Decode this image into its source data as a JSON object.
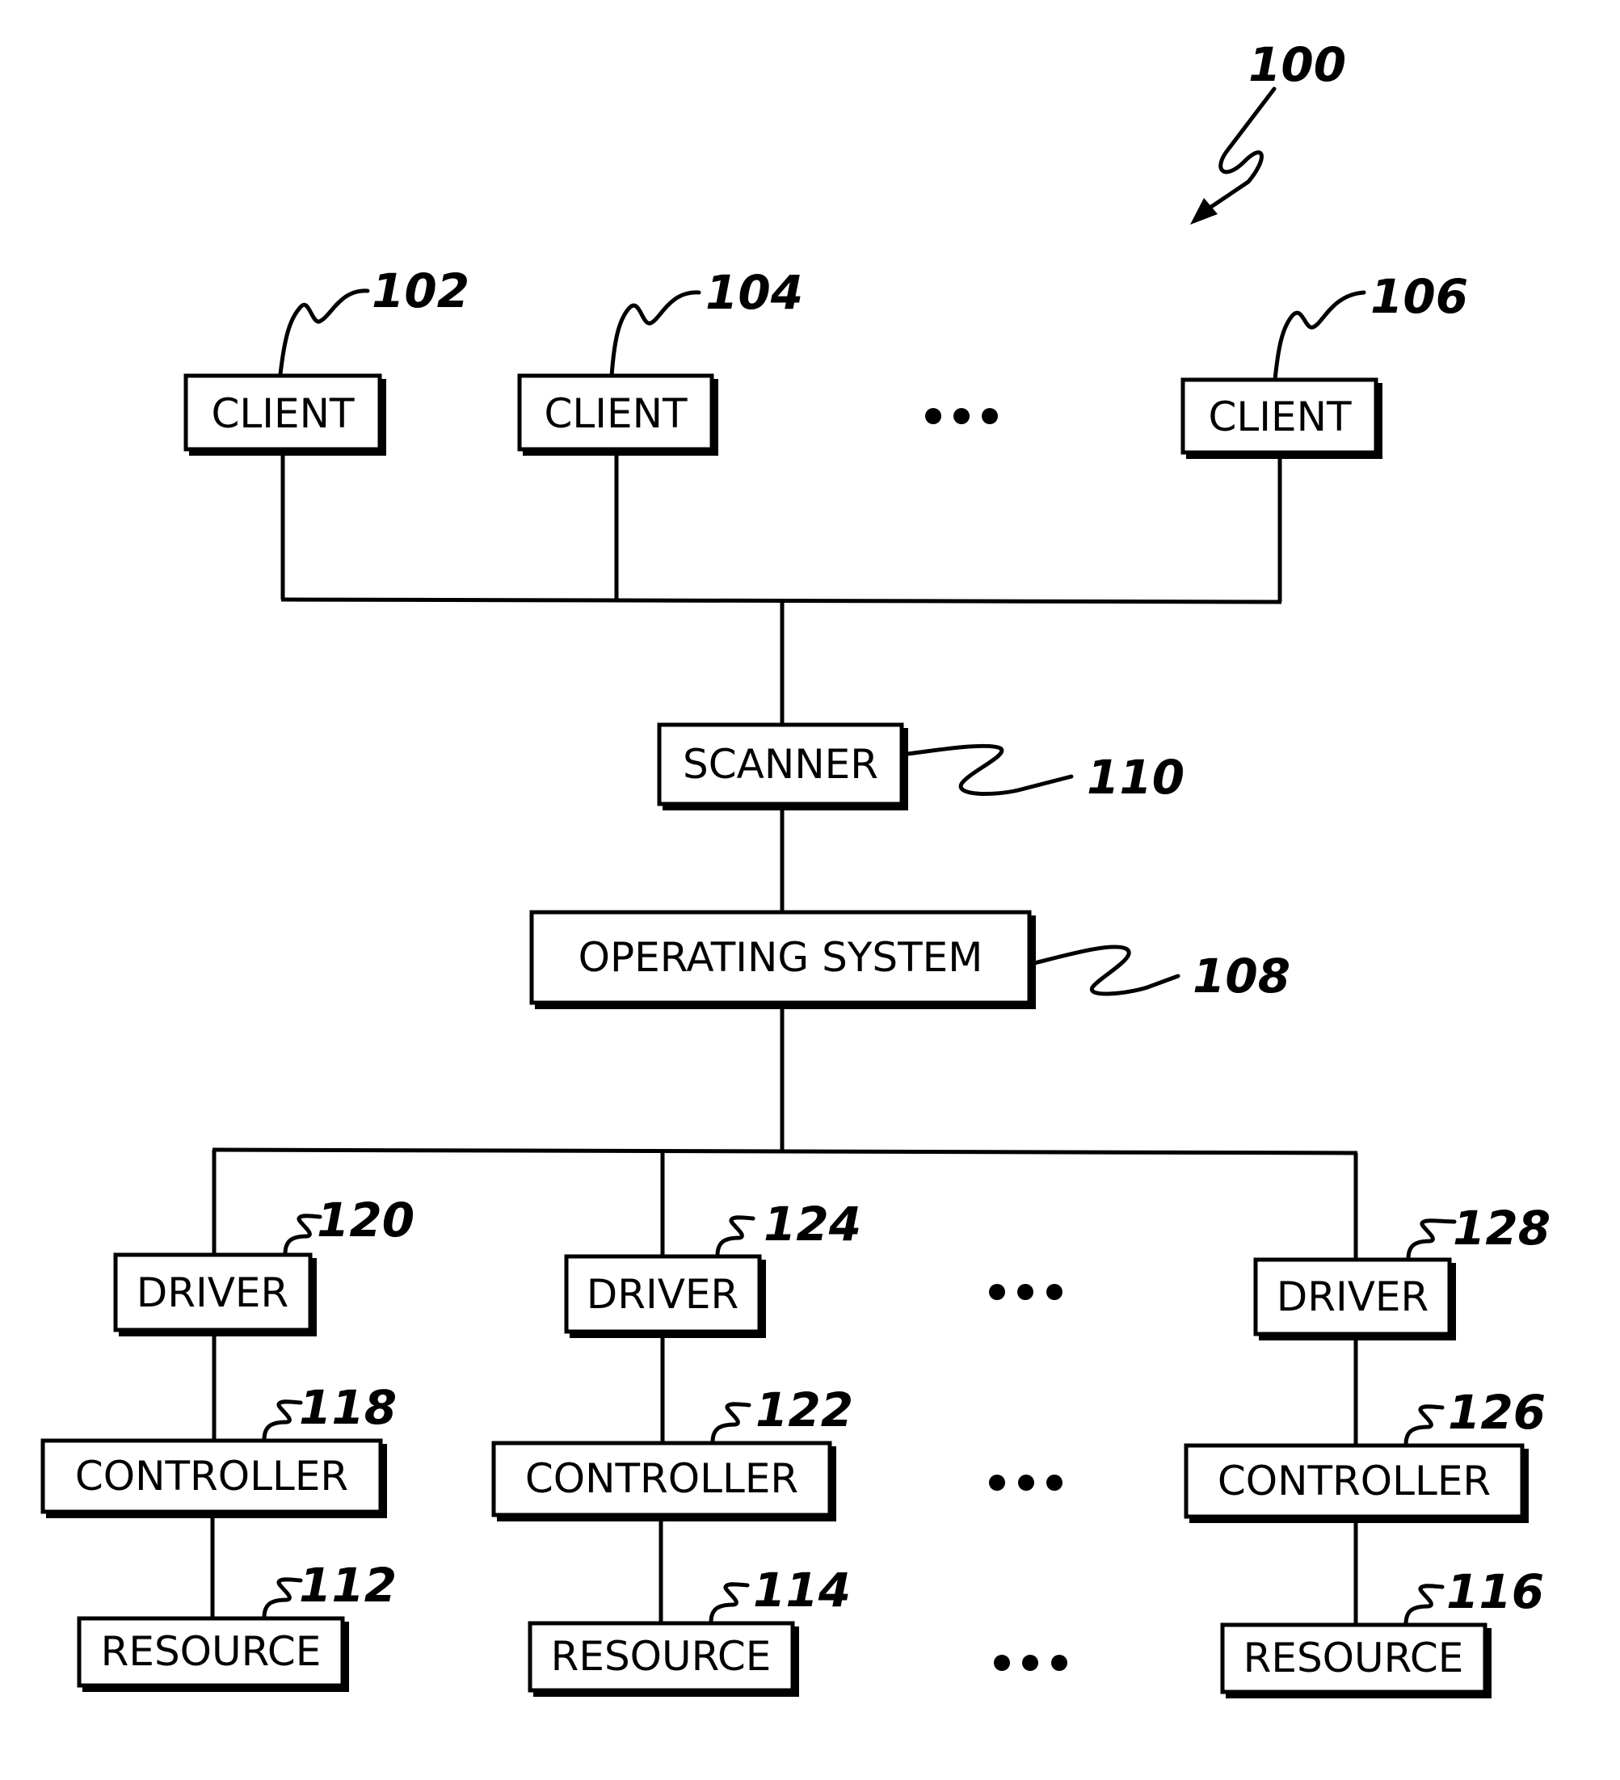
{
  "figure": {
    "ref": "100"
  },
  "clients": [
    {
      "label": "CLIENT",
      "ref": "102"
    },
    {
      "label": "CLIENT",
      "ref": "104"
    },
    {
      "label": "CLIENT",
      "ref": "106"
    }
  ],
  "scanner": {
    "label": "SCANNER",
    "ref": "110"
  },
  "operating_system": {
    "label": "OPERATING SYSTEM",
    "ref": "108"
  },
  "stacks": [
    {
      "driver": {
        "label": "DRIVER",
        "ref": "120"
      },
      "controller": {
        "label": "CONTROLLER",
        "ref": "118"
      },
      "resource": {
        "label": "RESOURCE",
        "ref": "112"
      }
    },
    {
      "driver": {
        "label": "DRIVER",
        "ref": "124"
      },
      "controller": {
        "label": "CONTROLLER",
        "ref": "122"
      },
      "resource": {
        "label": "RESOURCE",
        "ref": "114"
      }
    },
    {
      "driver": {
        "label": "DRIVER",
        "ref": "128"
      },
      "controller": {
        "label": "CONTROLLER",
        "ref": "126"
      },
      "resource": {
        "label": "RESOURCE",
        "ref": "116"
      }
    }
  ],
  "ellipsis": "•••"
}
